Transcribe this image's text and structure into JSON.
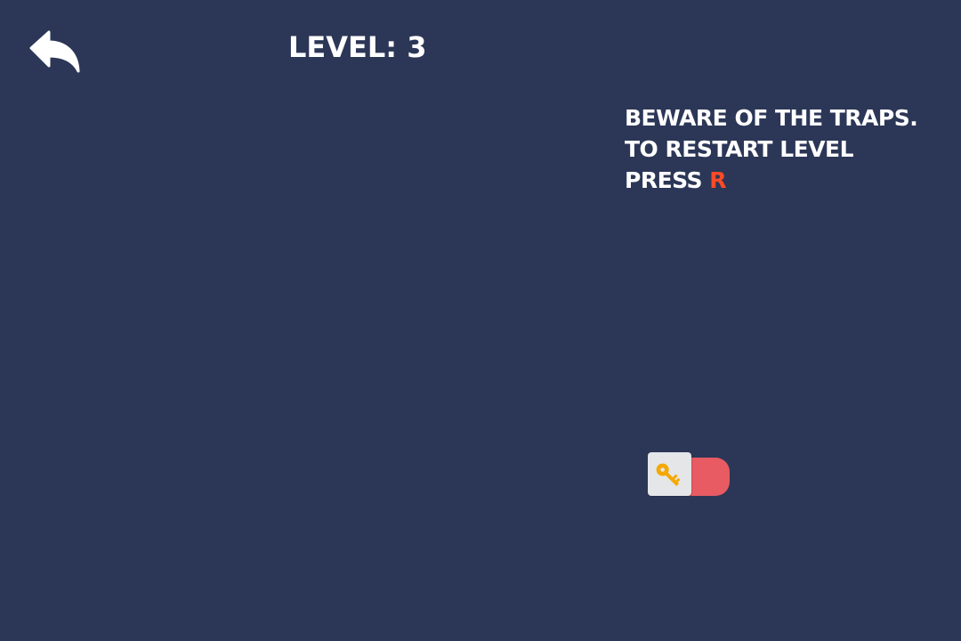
{
  "header": {
    "back_icon": "reply-arrow-icon",
    "level_label": "Level: 3"
  },
  "hint": {
    "line1": "Beware of the traps.",
    "line2": "To restart level",
    "line3_prefix": "press ",
    "restart_key": "R"
  },
  "key_switch": {
    "icon": "key-icon",
    "state": "off"
  },
  "colors": {
    "background": "#2c3757",
    "text": "#ffffff",
    "restart_key": "#ff4a27",
    "switch_track": "#e85b63",
    "switch_knob": "#e4e6e8",
    "key": "#f5a800"
  }
}
